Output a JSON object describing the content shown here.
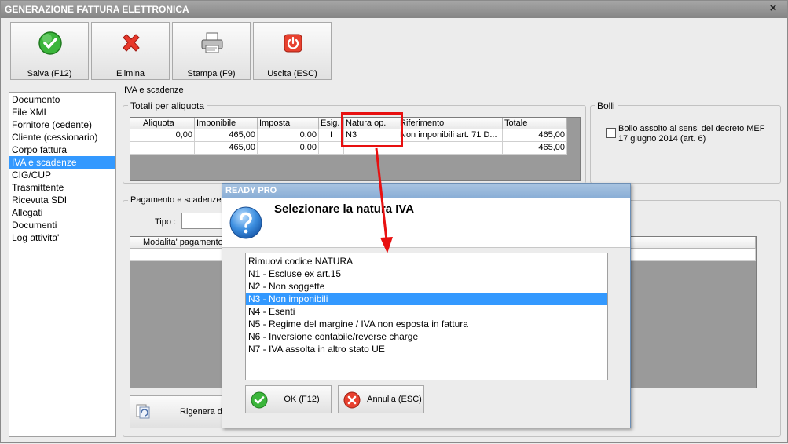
{
  "window": {
    "title": "GENERAZIONE FATTURA ELETTRONICA",
    "close_glyph": "×"
  },
  "toolbar": {
    "save_label": "Salva (F12)",
    "delete_label": "Elimina",
    "print_label": "Stampa (F9)",
    "exit_label": "Uscita (ESC)"
  },
  "nav": {
    "items": [
      "Documento",
      "File XML",
      "Fornitore (cedente)",
      "Cliente (cessionario)",
      "Corpo fattura",
      "IVA e scadenze",
      "CIG/CUP",
      "Trasmittente",
      "Ricevuta SDI",
      "Allegati",
      "Documenti",
      "Log attivita'"
    ],
    "selected": "IVA e scadenze"
  },
  "section_title": "IVA e scadenze",
  "totali": {
    "legend": "Totali per aliquota",
    "columns": [
      "Aliquota",
      "Imponibile",
      "Imposta",
      "Esig.",
      "Natura op.",
      "Riferimento",
      "Totale"
    ],
    "rows": [
      [
        "0,00",
        "465,00",
        "0,00",
        "I",
        "N3",
        "Non imponibili art. 71 D...",
        "465,00"
      ],
      [
        "",
        "465,00",
        "0,00",
        "",
        "",
        "",
        "465,00"
      ]
    ]
  },
  "bolli": {
    "legend": "Bolli",
    "checkbox_label_1": "Bollo assolto ai sensi del decreto MEF",
    "checkbox_label_2": "17 giugno 2014 (art. 6)"
  },
  "pagamento": {
    "legend": "Pagamento e scadenze",
    "tipo_label": "Tipo :",
    "grid_header": "Modalita' pagamento",
    "regenerate_label": "Rigenera da"
  },
  "dialog": {
    "title": "READY PRO",
    "heading": "Selezionare la natura IVA",
    "options": [
      "Rimuovi codice NATURA",
      "N1 - Escluse ex art.15",
      "N2 - Non soggette",
      "N3 - Non imponibili",
      "N4 - Esenti",
      "N5 - Regime del margine / IVA non esposta in fattura",
      "N6 - Inversione contabile/reverse charge",
      "N7 - IVA assolta in altro stato UE"
    ],
    "selected": "N3 - Non imponibili",
    "ok_label": "OK (F12)",
    "cancel_label": "Annulla (ESC)"
  },
  "colors": {
    "selection": "#3399ff",
    "annotation": "#e81010",
    "dialog_title": "#8aaed6"
  }
}
